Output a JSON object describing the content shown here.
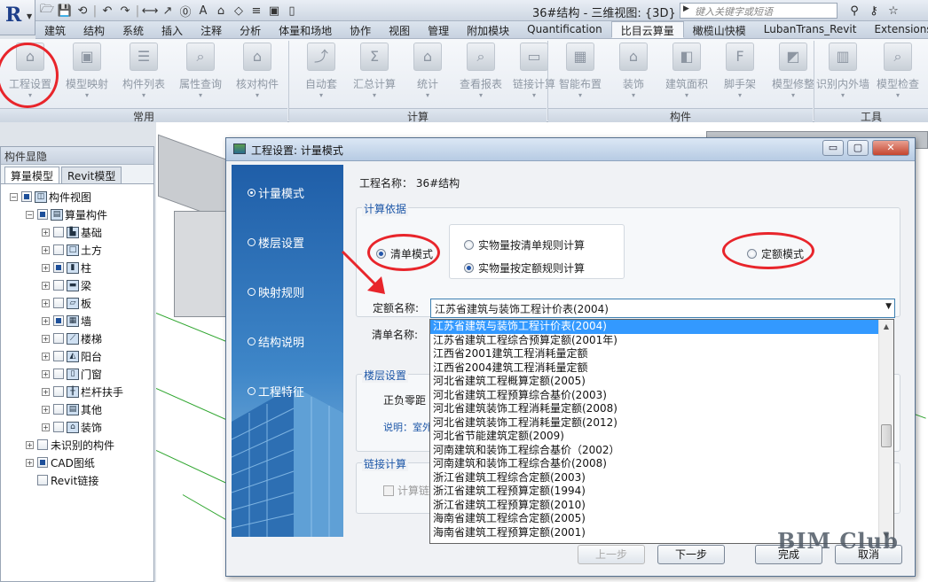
{
  "titlebar": {
    "window_title": "36#结构 - 三维视图: {3D}",
    "search_placeholder": "键入关键字或短语",
    "app_logo": "R",
    "qat_icons": [
      "open-icon",
      "save-icon",
      "sync-icon",
      "undo-icon",
      "redo-icon",
      "measure-icon",
      "dimension-icon",
      "tag-icon",
      "text-icon",
      "3d-icon",
      "section-icon",
      "thin-lines-icon",
      "close-hidden-icon",
      "switch-windows-icon"
    ],
    "right_icons": [
      "binoculars-icon",
      "key-icon",
      "star-icon"
    ]
  },
  "tabs": [
    "建筑",
    "结构",
    "系统",
    "插入",
    "注释",
    "分析",
    "体量和场地",
    "协作",
    "视图",
    "管理",
    "附加模块",
    "Quantification",
    "比目云算量",
    "橄榄山快模",
    "LubanTrans_Revit",
    "Extensions"
  ],
  "active_tab": "比目云算量",
  "ribbon": {
    "groups": [
      {
        "name": "常用",
        "buttons": [
          "工程设置",
          "模型映射",
          "构件列表",
          "属性查询",
          "核对构件"
        ]
      },
      {
        "name": "计算",
        "buttons": [
          "自动套",
          "汇总计算",
          "统计",
          "查看报表",
          "链接计算"
        ]
      },
      {
        "name": "构件",
        "buttons": [
          "智能布置",
          "装饰",
          "建筑面积",
          "脚手架",
          "模型修整"
        ]
      },
      {
        "name": "工具",
        "buttons": [
          "识别内外墙",
          "模型检查"
        ]
      }
    ],
    "button_icons": {
      "工程设置": "house-gear-icon",
      "模型映射": "cube-map-icon",
      "构件列表": "list-icon",
      "属性查询": "query-icon",
      "核对构件": "check-icon",
      "自动套": "auto-icon",
      "汇总计算": "sigma-icon",
      "统计": "house-chart-icon",
      "查看报表": "report-icon",
      "链接计算": "link-pc-icon",
      "智能布置": "grid-plus-icon",
      "装饰": "house-plus-icon",
      "建筑面积": "floor-area-icon",
      "脚手架": "scaffold-front-icon",
      "模型修整": "model-edit-icon",
      "识别内外墙": "wall-identify-icon",
      "模型检查": "model-check-icon"
    },
    "scaffold_badge": "Front"
  },
  "left_panel": {
    "title": "构件显隐",
    "tabs": [
      "算量模型",
      "Revit模型"
    ],
    "tree": [
      {
        "label": "构件视图",
        "level": 0,
        "expander": "−",
        "icon": "view-icon"
      },
      {
        "label": "算量构件",
        "level": 1,
        "expander": "−",
        "icon": "folder-icon"
      },
      {
        "label": "基础",
        "level": 2,
        "expander": "+",
        "icon": "foundation-icon"
      },
      {
        "label": "土方",
        "level": 2,
        "expander": "+",
        "icon": "earthwork-icon"
      },
      {
        "label": "柱",
        "level": 2,
        "expander": "+",
        "icon": "column-icon"
      },
      {
        "label": "梁",
        "level": 2,
        "expander": "+",
        "icon": "beam-icon"
      },
      {
        "label": "板",
        "level": 2,
        "expander": "+",
        "icon": "slab-icon"
      },
      {
        "label": "墙",
        "level": 2,
        "expander": "+",
        "icon": "wall-icon"
      },
      {
        "label": "楼梯",
        "level": 2,
        "expander": "+",
        "icon": "stair-icon"
      },
      {
        "label": "阳台",
        "level": 2,
        "expander": "+",
        "icon": "balcony-icon"
      },
      {
        "label": "门窗",
        "level": 2,
        "expander": "+",
        "icon": "door-window-icon"
      },
      {
        "label": "栏杆扶手",
        "level": 2,
        "expander": "+",
        "icon": "railing-icon"
      },
      {
        "label": "其他",
        "level": 2,
        "expander": "+",
        "icon": "other-icon"
      },
      {
        "label": "装饰",
        "level": 2,
        "expander": "+",
        "icon": "decoration-icon"
      },
      {
        "label": "未识别的构件",
        "level": 1,
        "expander": "+",
        "icon": ""
      },
      {
        "label": "CAD图纸",
        "level": 1,
        "expander": "+",
        "icon": ""
      },
      {
        "label": "Revit链接",
        "level": 1,
        "expander": "",
        "icon": ""
      }
    ]
  },
  "dialog": {
    "title": "工程设置: 计量模式",
    "window_buttons": [
      "▭",
      "▢",
      "✕"
    ],
    "side_items": [
      "计量模式",
      "楼层设置",
      "映射规则",
      "结构说明",
      "工程特征"
    ],
    "active_side": "计量模式",
    "project_label": "工程名称：",
    "project_name": "36#结构",
    "calc_basis_legend": "计算依据",
    "mode_list": "清单模式",
    "mode_quota": "定额模式",
    "rule_option_1": "实物量按清单规则计算",
    "rule_option_2": "实物量按定额规则计算",
    "quota_name_label": "定额名称:",
    "list_name_label": "清单名称:",
    "quota_selected": "江苏省建筑与装饰工程计价表(2004)",
    "quota_options": [
      "江苏省建筑与装饰工程计价表(2004)",
      "江苏省建筑工程综合预算定额(2001年)",
      "江西省2001建筑工程消耗量定额",
      "江西省2004建筑工程消耗量定额",
      "河北省建筑工程概算定额(2005)",
      "河北省建筑工程预算综合基价(2003)",
      "河北省建筑装饰工程消耗量定额(2008)",
      "河北省建筑装饰工程消耗量定额(2012)",
      "河北省节能建筑定额(2009)",
      "河南建筑和装饰工程综合基价（2002）",
      "河南建筑和装饰工程综合基价(2008)",
      "浙江省建筑工程综合定额(2003)",
      "浙江省建筑工程预算定额(1994)",
      "浙江省建筑工程预算定额(2010)",
      "海南省建筑工程综合定额(2005)",
      "海南省建筑工程预算定额(2001)"
    ],
    "floor_legend": "楼层设置",
    "floor_partial": "正负零距",
    "note_partial": "说明：室外",
    "link_legend": "链接计算",
    "link_checkbox": "计算链",
    "buttons": {
      "prev": "上一步",
      "next": "下一步",
      "finish": "完成",
      "cancel": "取消"
    }
  },
  "watermark": "BIM Club",
  "colors": {
    "selection": "#3399ff",
    "annotation_red": "#e8252b",
    "link_blue": "#1d57a8"
  }
}
